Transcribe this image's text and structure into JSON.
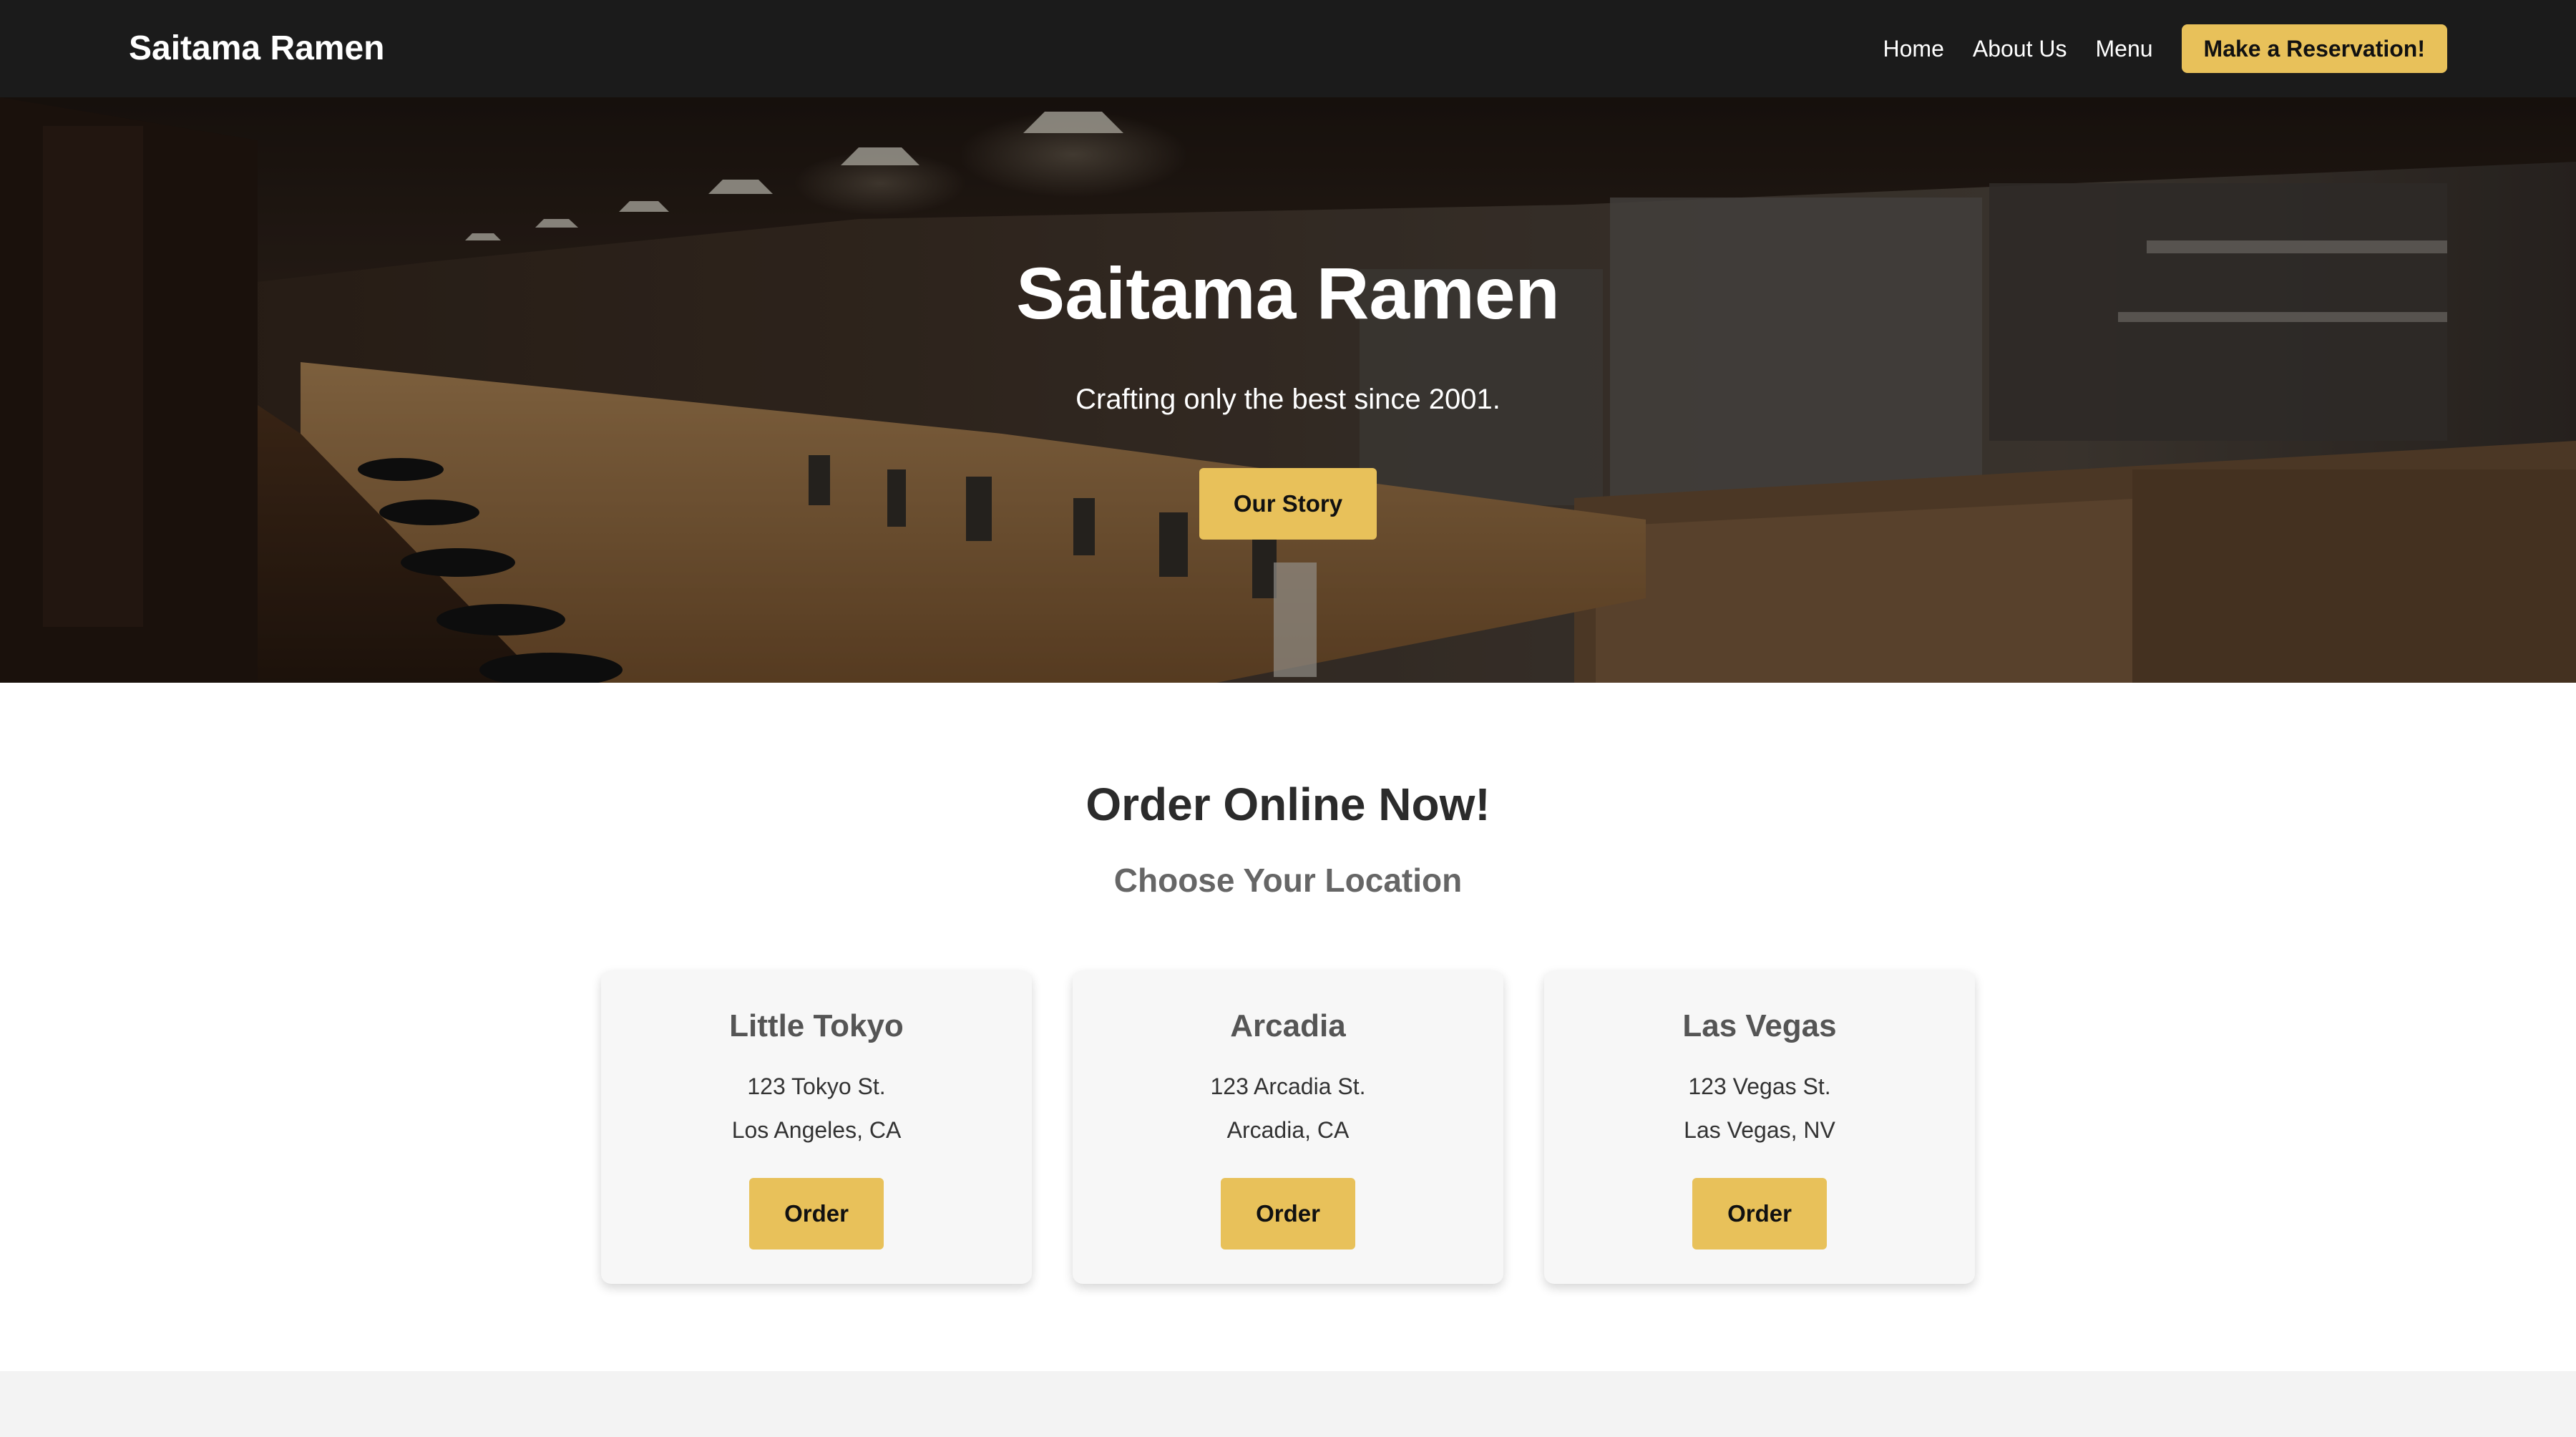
{
  "navbar": {
    "brand": "Saitama Ramen",
    "links": [
      "Home",
      "About Us",
      "Menu"
    ],
    "reservation_button": "Make a Reservation!"
  },
  "hero": {
    "title": "Saitama Ramen",
    "tagline": "Crafting only the best since 2001.",
    "button": "Our Story",
    "image": "ramen-shop-counter-photo"
  },
  "order": {
    "title": "Order Online Now!",
    "subtitle": "Choose Your Location",
    "locations": [
      {
        "name": "Little Tokyo",
        "street": "123 Tokyo St.",
        "city": "Los Angeles, CA",
        "button": "Order"
      },
      {
        "name": "Arcadia",
        "street": "123 Arcadia St.",
        "city": "Arcadia, CA",
        "button": "Order"
      },
      {
        "name": "Las Vegas",
        "street": "123 Vegas St.",
        "city": "Las Vegas, NV",
        "button": "Order"
      }
    ]
  },
  "colors": {
    "accent": "#e8c15a",
    "navbar": "#1b1b1b",
    "card": "#f7f7f7",
    "footer": "#f3f3f3"
  }
}
